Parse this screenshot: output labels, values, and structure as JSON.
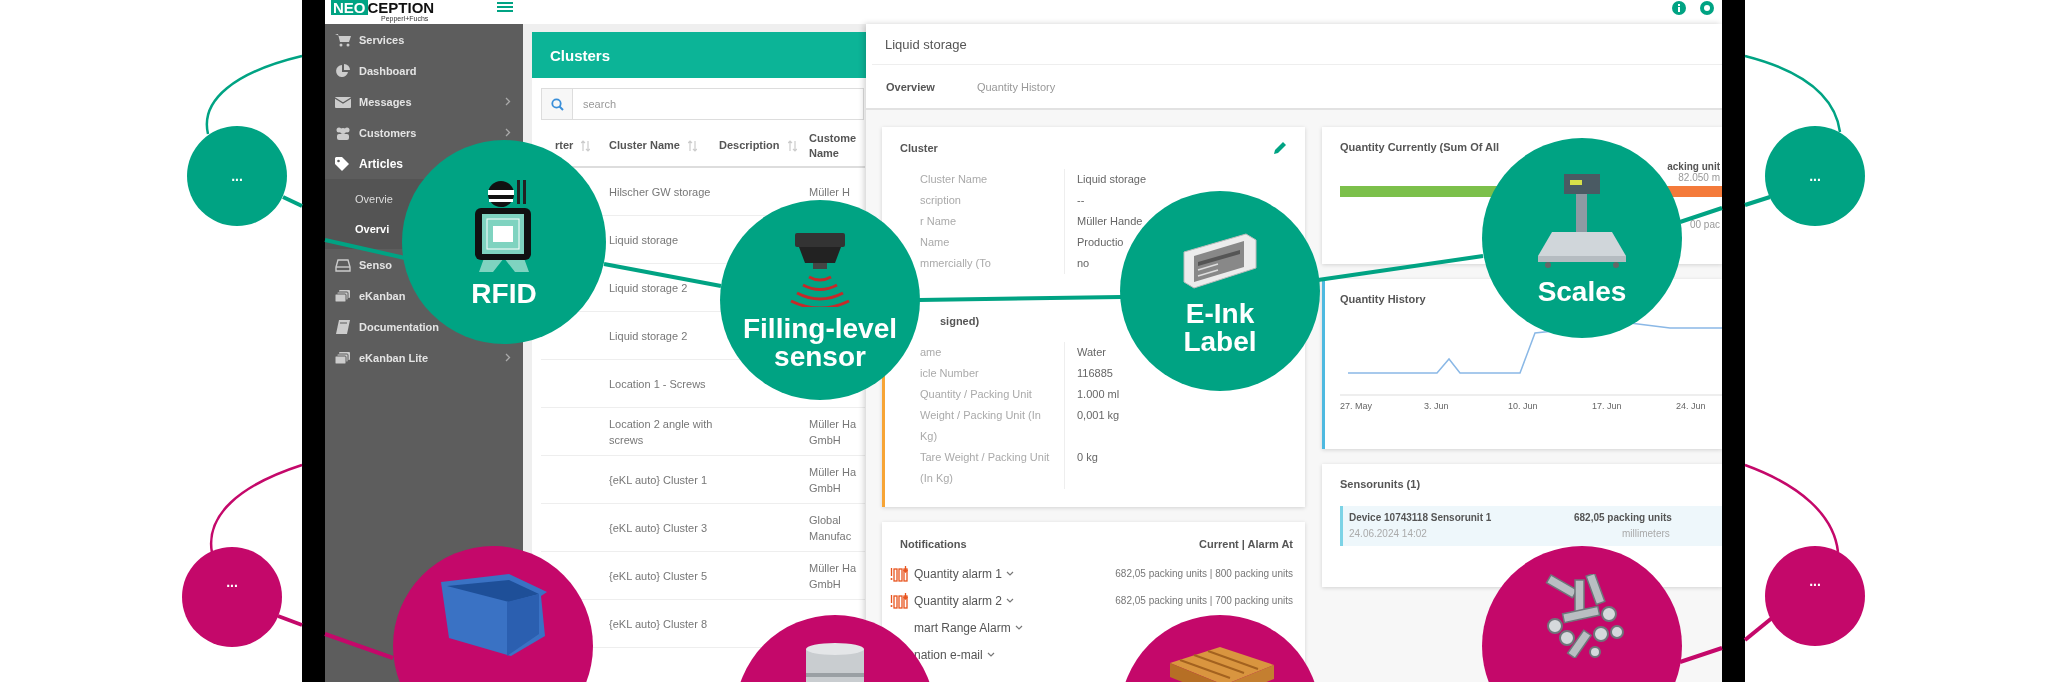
{
  "top_bar": {
    "logo_prefix": "NEO",
    "logo_suffix": "CEPTION",
    "logo_subtitle": "Pepperl+Fuchs"
  },
  "sidebar": {
    "items": [
      {
        "label": "Services",
        "selected": false,
        "expandable": false
      },
      {
        "label": "Dashboard",
        "selected": false,
        "expandable": false
      },
      {
        "label": "Messages",
        "selected": false,
        "expandable": true
      },
      {
        "label": "Customers",
        "selected": false,
        "expandable": true
      },
      {
        "label": "Articles",
        "selected": true,
        "expandable": false,
        "children": [
          {
            "label": "Overvie",
            "selected": false
          },
          {
            "label": "Overvi",
            "selected": true
          }
        ]
      },
      {
        "label": "Senso",
        "selected": false,
        "expandable": false
      },
      {
        "label": "eKanban",
        "selected": false,
        "expandable": false
      },
      {
        "label": "Documentation",
        "selected": false,
        "expandable": false
      },
      {
        "label": "eKanban Lite",
        "selected": false,
        "expandable": true
      }
    ]
  },
  "clusters": {
    "title": "Clusters",
    "search": {
      "placeholder": "search"
    },
    "columns": [
      "rter",
      "Cluster Name",
      "Description",
      "Custome Name"
    ],
    "rows": [
      {
        "cluster_name": "Hilscher GW storage",
        "customer": "Müller H"
      },
      {
        "cluster_name": "Liquid storage"
      },
      {
        "cluster_name": "Liquid storage 2"
      },
      {
        "cluster_name": "Liquid storage 2"
      },
      {
        "cluster_name": "Location 1 - Screws"
      },
      {
        "cluster_name": "Location 2 angle with screws",
        "customer": "Müller Ha GmbH"
      },
      {
        "cluster_name": "{eKL auto} Cluster 1",
        "customer": "Müller Ha GmbH"
      },
      {
        "cluster_name": "{eKL auto} Cluster 3",
        "customer": "Global Manufac"
      },
      {
        "cluster_name": "{eKL auto} Cluster 5",
        "customer": "Müller Ha GmbH"
      },
      {
        "cluster_name": "{eKL auto} Cluster 8"
      }
    ]
  },
  "detail": {
    "title": "Liquid storage",
    "tabs": [
      {
        "label": "Overview",
        "selected": true
      },
      {
        "label": "Quantity History",
        "selected": false
      }
    ],
    "cluster_card": {
      "title": "Cluster",
      "fields": [
        {
          "label": "Cluster Name",
          "value": "Liquid storage"
        },
        {
          "label": "scription",
          "value": "--"
        },
        {
          "label": "r Name",
          "value": "Müller Hande"
        },
        {
          "label": "Name",
          "value": "Productio"
        },
        {
          "label": "mmercially (To",
          "value": "no"
        }
      ]
    },
    "article_card": {
      "title": "signed)",
      "fields": [
        {
          "label": "ame",
          "value": "Water"
        },
        {
          "label": "icle Number",
          "value": "116885"
        },
        {
          "label": "Quantity / Packing Unit",
          "value": "1.000 ml"
        },
        {
          "label": "Weight / Packing Unit (In Kg)",
          "value": "0,001 kg"
        },
        {
          "label": "Tare Weight / Packing Unit (In Kg)",
          "value": "0 kg"
        }
      ]
    },
    "notifications": {
      "title": "Notifications",
      "header": "Current | Alarm At",
      "items": [
        {
          "name": "Quantity alarm 1",
          "alarm_icon": true,
          "reading": "682,05 packing units | 800 packing units"
        },
        {
          "name": "Quantity alarm 2",
          "alarm_icon": true,
          "reading": "682,05 packing units | 700 packing units"
        },
        {
          "name": "mart Range Alarm",
          "alarm_icon": false
        },
        {
          "name": "nation e-mail",
          "alarm_icon": false
        }
      ]
    },
    "quantity_card": {
      "title": "Quantity Currently (Sum Of All",
      "unit_text": "acking unit",
      "reading": "82.050 m",
      "limit_text": "00 pac",
      "level": 0.85
    },
    "history_card": {
      "title": "Quantity History",
      "x_labels": [
        "27. May",
        "3. Jun",
        "10. Jun",
        "17. Jun",
        "24. Jun"
      ]
    },
    "sensorunits_card": {
      "title": "Sensorunits (1)",
      "device": "Device 10743118 Sensorunit 1",
      "time": "24.06.2024 14:02",
      "quantity": "682,05 packing units",
      "reading": "millimeters"
    }
  },
  "features": [
    {
      "kind": "more",
      "label": "...",
      "color": "#00a383"
    },
    {
      "kind": "main",
      "label": "RFID",
      "color": "#00a383"
    },
    {
      "kind": "main",
      "label": "Filling-level sensor",
      "color": "#00a383"
    },
    {
      "kind": "main",
      "label": "E-Ink Label",
      "color": "#00a383"
    },
    {
      "kind": "main",
      "label": "Scales",
      "color": "#00a383"
    },
    {
      "kind": "more",
      "label": "...",
      "color": "#00a383"
    },
    {
      "kind": "more",
      "label": "...",
      "color": "#c4086a"
    },
    {
      "kind": "main",
      "color": "#c4086a"
    },
    {
      "kind": "main",
      "color": "#c4086a"
    },
    {
      "kind": "main",
      "color": "#c4086a"
    },
    {
      "kind": "main",
      "color": "#c4086a"
    },
    {
      "kind": "more",
      "label": "...",
      "color": "#c4086a"
    }
  ]
}
